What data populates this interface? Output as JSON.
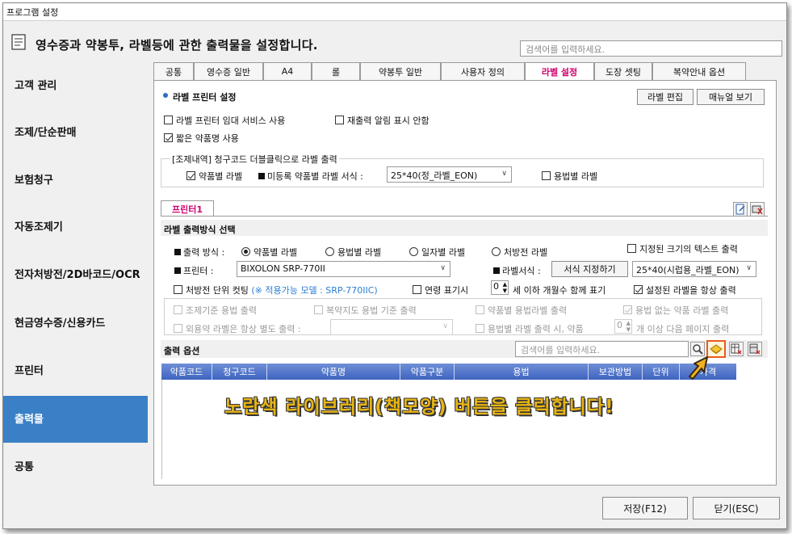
{
  "window": {
    "title": "프로그램 설정"
  },
  "header": {
    "text": "영수증과 약봉투, 라벨등에 관한 출력물을 설정합니다.",
    "search_placeholder": "검색어를 입력하세요."
  },
  "sidebar": {
    "items": [
      {
        "label": "고객 관리"
      },
      {
        "label": "조제/단순판매"
      },
      {
        "label": "보험청구"
      },
      {
        "label": "자동조제기"
      },
      {
        "label": "전자처방전/2D바코드/OCR"
      },
      {
        "label": "현금영수증/신용카드"
      },
      {
        "label": "프린터"
      },
      {
        "label": "출력물"
      },
      {
        "label": "공통"
      }
    ],
    "active_index": 7
  },
  "tabs": [
    {
      "label": "공통"
    },
    {
      "label": "영수증 일반"
    },
    {
      "label": "A4"
    },
    {
      "label": "롤"
    },
    {
      "label": "약봉투 일반"
    },
    {
      "label": "사용자 정의"
    },
    {
      "label": "라벨 설정"
    },
    {
      "label": "도장 셋팅"
    },
    {
      "label": "복약안내 옵션"
    }
  ],
  "label_printer": {
    "section_title": "라벨 프린터 설정",
    "edit_button": "라벨 편집",
    "manual_button": "매뉴얼 보기",
    "opt_temp_service": "라벨 프린터 임대 서비스 사용",
    "opt_no_reprint_alert": "재출력 알림 표시 안함",
    "opt_short_name": "짧은 약품명 사용",
    "group_title": "[조제내역] 청구코드 더블클릭으로 라벨 출력",
    "opt_drug_label": "약품별 라벨",
    "unregistered_label": "미등록 약품별 라벨 서식 :",
    "unregistered_value": "25*40(정_라벨_EON)",
    "opt_usage_label": "용법별 라벨"
  },
  "printer_tab": {
    "label": "프린터1"
  },
  "output_method": {
    "section_title": "라벨 출력방식 선택",
    "method_label": "출력 방식 :",
    "radio_drug": "약품별 라벨",
    "radio_usage": "용법별 라벨",
    "radio_date": "일자별 라벨",
    "radio_rx": "처방전 라벨",
    "opt_fixed_size": "지정된 크기의 텍스트 출력",
    "printer_label": "프린터 :",
    "printer_value": "BIXOLON SRP-770II",
    "format_label": "라벨서식 :",
    "format_button": "서식 지정하기",
    "format_value": "25*40(시럽용_라벨_EON)",
    "opt_cut_per_rx": "처방전 단위 컷팅",
    "cut_note": "(※ 적용가능 모델 : SRP-770IIC)",
    "opt_age": "연령 표기시",
    "age_value": "0",
    "age_suffix": "세 이하 개월수 함께 표기",
    "opt_always_selected": "설정된 라벨을 항상 출력",
    "opt_dispense_usage": "조제기준 용법 출력",
    "opt_guide_usage": "복약지도 용법 기준 출력",
    "opt_drug_usage_label": "약품별 용법라벨 출력",
    "opt_no_usage_label": "용법 없는 약품 라벨 출력",
    "opt_external_separate": "외용약 라벨은 항상 별도 출력 :",
    "opt_page_break_prefix": "용법별 라벨 출력 시, 약품",
    "page_break_value": "0",
    "page_break_suffix": "개 이상 다음 페이지 출력"
  },
  "output_options": {
    "section_title": "출력 옵션",
    "search_placeholder": "검색어를 입력하세요.",
    "columns": [
      "약품코드",
      "청구코드",
      "약품명",
      "약품구분",
      "용법",
      "보관방법",
      "단위",
      "가격"
    ]
  },
  "annotation": "노란색 라이브러리(책모양) 버튼을 클릭합니다!",
  "footer": {
    "save_button": "저장(F12)",
    "close_button": "닫기(ESC)"
  },
  "colors": {
    "accent": "#3a80c6",
    "active_tab": "#d0006e",
    "grid_header": "#4a6fc6",
    "annotation": "#e8b414",
    "highlight": "#e85a20"
  }
}
